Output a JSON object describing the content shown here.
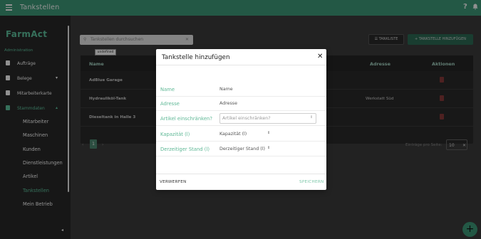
{
  "topbar": {
    "title": "Tankstellen",
    "help": "?",
    "icons": [
      "menu-icon",
      "help-icon",
      "bell-icon"
    ]
  },
  "sidebar": {
    "logo": "FarmAct",
    "section_label": "Administration",
    "items": [
      {
        "label": "Aufträge",
        "icon": "clipboard-icon"
      },
      {
        "label": "Belege",
        "icon": "receipt-icon",
        "chevron": "▾"
      },
      {
        "label": "Mitarbeiterkarte",
        "icon": "people-icon"
      },
      {
        "label": "Stammdaten",
        "icon": "hierarchy-icon",
        "chevron": "▴"
      }
    ],
    "subitems": [
      "Mitarbeiter",
      "Maschinen",
      "Kunden",
      "Dienstleistungen",
      "Artikel",
      "Tankstellen",
      "Mein Betrieb"
    ],
    "collapse": "◂"
  },
  "toolbar": {
    "search_placeholder": "Tankstellen durchsuchen",
    "clear": "✕",
    "tooltip": "undefined",
    "list_button": "TANKLISTE",
    "add_button": "+ TANKSTELLE HINZUFÜGEN"
  },
  "table": {
    "headers": [
      "Name",
      "Adresse",
      "Aktionen"
    ],
    "rows": [
      {
        "name": "AdBlue Garage",
        "address": ""
      },
      {
        "name": "Hydrauliköl-Tank",
        "address": "Werkstatt Süd"
      },
      {
        "name": "Dieseltank in Halle 3",
        "address": ""
      }
    ]
  },
  "pagination": {
    "prev": "‹",
    "page": "1",
    "next": "›",
    "per_page_label": "Einträge pro Seite:",
    "per_page_value": "10",
    "per_page_clear": "✕"
  },
  "fab": "+",
  "dialog": {
    "title": "Tankstelle hinzufügen",
    "close": "✕",
    "fields": [
      {
        "label": "Name",
        "placeholder": "Name"
      },
      {
        "label": "Adresse",
        "placeholder": "Adresse"
      },
      {
        "label": "Artikel einschränken?",
        "placeholder": "Artikel einschränken?"
      },
      {
        "label": "Kapazität (l)",
        "placeholder": "Kapazität (l)"
      },
      {
        "label": "Derzeitiger Stand (l)",
        "placeholder": "Derzeitiger Stand (l)"
      }
    ],
    "discard": "VERWERFEN",
    "save": "SPEICHERN"
  },
  "colors": {
    "accent": "#3e9b7a",
    "accent_text": "#5fc6a0",
    "sidebar_bg": "#2a2a2a",
    "danger": "#8a3a3a"
  }
}
